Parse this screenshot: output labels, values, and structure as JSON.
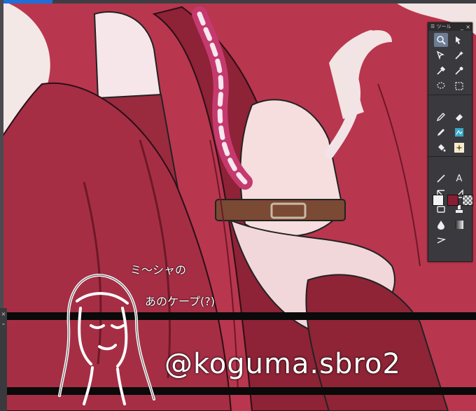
{
  "app": {
    "palette_title": "ツール",
    "palette_controls": [
      "_",
      "×"
    ]
  },
  "tools": [
    {
      "id": "zoom",
      "icon": "zoom-icon",
      "active": true
    },
    {
      "id": "move",
      "icon": "move-icon"
    },
    {
      "id": "object",
      "icon": "object-select-icon"
    },
    {
      "id": "magic-wand",
      "icon": "magic-wand-icon"
    },
    {
      "id": "eyedropper",
      "icon": "eyedropper-icon"
    },
    {
      "id": "eyedropper2",
      "icon": "eyedropper-alt-icon"
    },
    {
      "id": "lasso",
      "icon": "lasso-icon"
    },
    {
      "id": "marquee",
      "icon": "marquee-icon"
    },
    {
      "id": "pen",
      "icon": "pen-icon"
    },
    {
      "id": "eraser",
      "icon": "eraser-icon"
    },
    {
      "id": "pencil",
      "icon": "pencil-icon"
    },
    {
      "id": "decoration",
      "icon": "decoration-icon"
    },
    {
      "id": "fill",
      "icon": "fill-bucket-icon"
    },
    {
      "id": "gradient-sparkle",
      "icon": "sparkle-icon"
    },
    {
      "id": "line",
      "icon": "line-icon"
    },
    {
      "id": "text",
      "icon": "text-icon",
      "label": "A"
    },
    {
      "id": "vector",
      "icon": "vector-icon"
    },
    {
      "id": "ruler",
      "icon": "ruler-icon"
    },
    {
      "id": "frame",
      "icon": "frame-icon"
    },
    {
      "id": "stamp",
      "icon": "stamp-icon"
    },
    {
      "id": "blend",
      "icon": "blend-icon"
    },
    {
      "id": "gradient",
      "icon": "gradient-icon"
    },
    {
      "id": "correct",
      "icon": "correct-line-icon"
    }
  ],
  "colors": {
    "main": "#f2f2f2",
    "sub": "#8c1c34",
    "transparent": "checker"
  },
  "side_panel": {
    "close_glyph": "×",
    "arrow_glyph": "⌄"
  },
  "overlay": {
    "note_line1": "ミ〜シャの",
    "note_line2": "あのケープ(?)",
    "signature": "@koguma.sbro2"
  }
}
